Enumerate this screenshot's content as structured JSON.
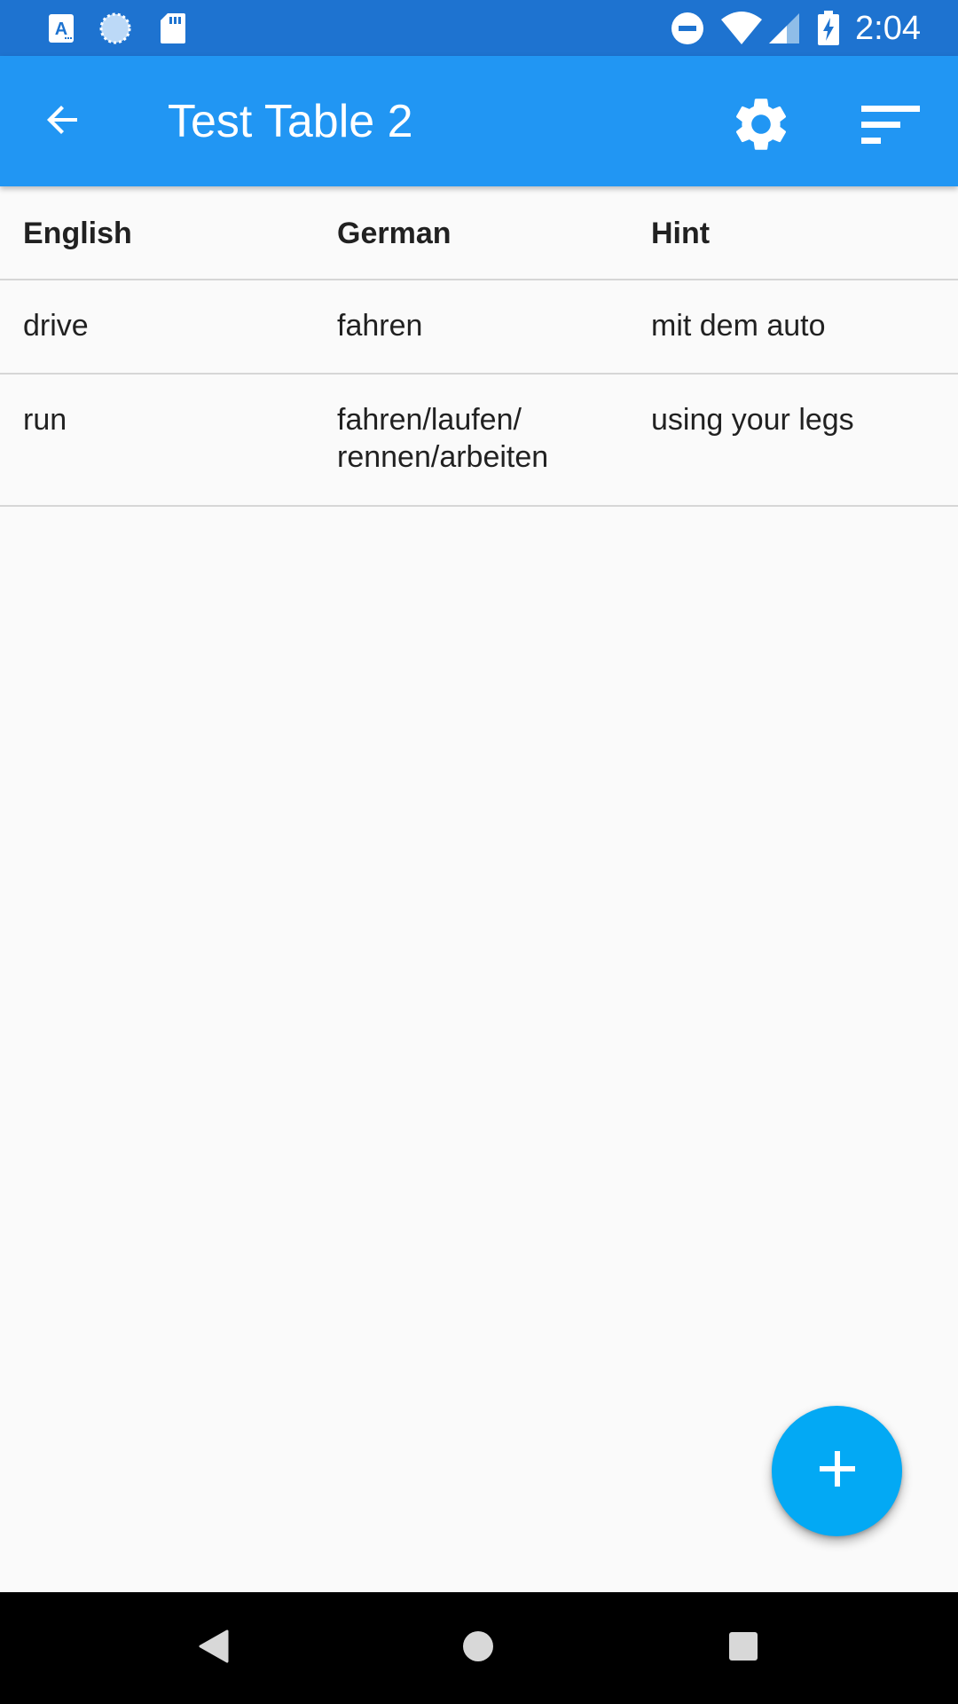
{
  "status_bar": {
    "time": "2:04",
    "icons": [
      "text-a-icon",
      "sync-icon",
      "sd-card-icon",
      "do-not-disturb-icon",
      "wifi-icon",
      "cell-signal-icon",
      "battery-charging-icon"
    ]
  },
  "app_bar": {
    "title": "Test Table 2",
    "back_icon": "arrow-back-icon",
    "settings_icon": "gear-icon",
    "sort_icon": "sort-icon"
  },
  "table": {
    "columns": [
      "English",
      "German",
      "Hint"
    ],
    "rows": [
      {
        "english": "drive",
        "german": "fahren",
        "hint": "mit dem auto"
      },
      {
        "english": "run",
        "german": "fahren/laufen/\nrennen/arbeiten",
        "hint": "using your legs"
      }
    ]
  },
  "fab": {
    "icon": "plus-icon"
  },
  "colors": {
    "status_bar": "#1e73d0",
    "app_bar": "#2196f3",
    "fab": "#03a9f4",
    "background": "#fafafa"
  }
}
